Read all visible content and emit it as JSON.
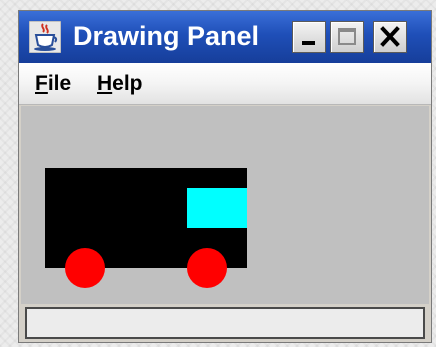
{
  "window": {
    "title": "Drawing Panel",
    "minimize_icon": "minimize-icon",
    "maximize_icon": "maximize-icon",
    "close_icon": "close-icon",
    "app_icon": "java-coffee-cup-icon"
  },
  "menu": {
    "items": [
      {
        "mnemonic": "F",
        "rest": "ile"
      },
      {
        "mnemonic": "H",
        "rest": "elp"
      }
    ]
  },
  "canvas": {
    "background": "#c0c0c0",
    "colors": {
      "car_body": "#000000",
      "window": "#00ffff",
      "wheels": "#ff0000"
    }
  },
  "status": {
    "text": ""
  }
}
